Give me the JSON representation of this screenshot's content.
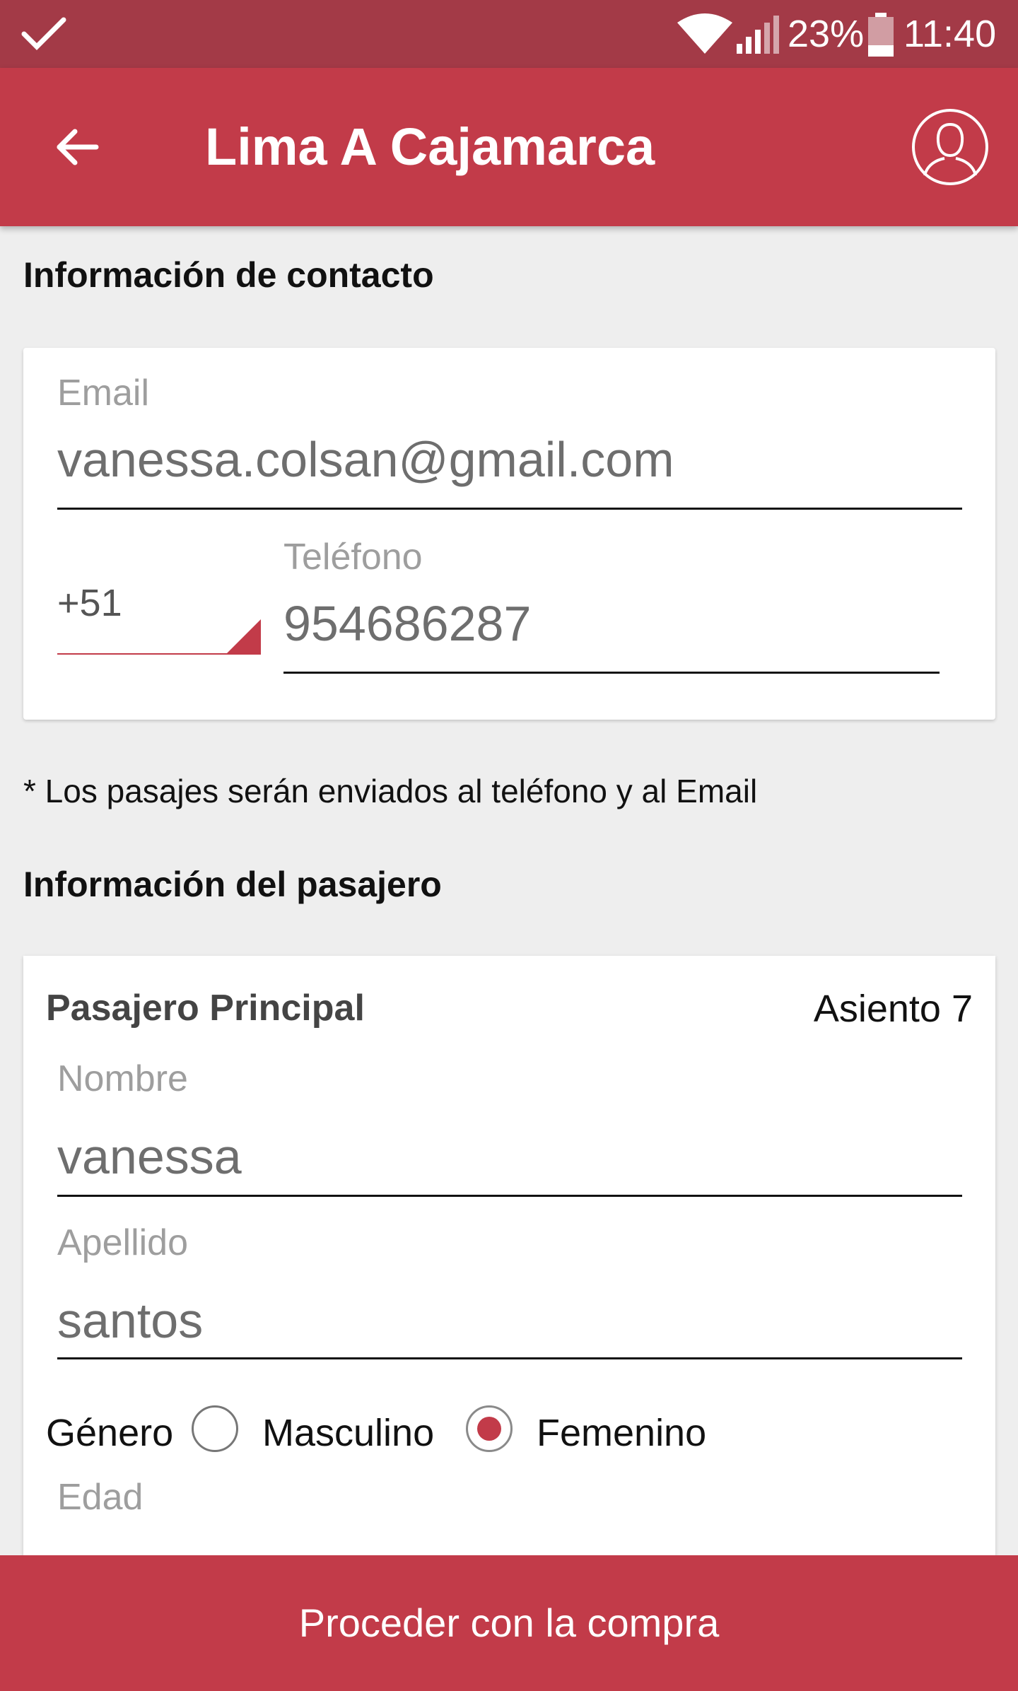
{
  "status_bar": {
    "battery": "23%",
    "time": "11:40",
    "icons": [
      "check-icon",
      "wifi-icon",
      "signal-icon",
      "battery-icon"
    ]
  },
  "toolbar": {
    "title": "Lima A Cajamarca",
    "back_icon": "arrow-left-icon",
    "profile_icon": "user-avatar-icon"
  },
  "contact": {
    "section_title": "Información de contacto",
    "email_label": "Email",
    "email_value": "vanessa.colsan@gmail.com",
    "country_code": "+51",
    "phone_label": "Teléfono",
    "phone_value": "954686287",
    "note": "* Los pasajes serán enviados al teléfono y al Email"
  },
  "passenger": {
    "section_title": "Información del pasajero",
    "card_title": "Pasajero Principal",
    "seat": "Asiento 7",
    "name_label": "Nombre",
    "name_value": "vanessa",
    "lastname_label": "Apellido",
    "lastname_value": "santos",
    "gender_label": "Género",
    "gender_options": [
      "Masculino",
      "Femenino"
    ],
    "gender_selected": "Femenino",
    "age_label": "Edad"
  },
  "actions": {
    "proceed_label": "Proceder con la compra"
  },
  "colors": {
    "accent": "#c23b49",
    "status_bar": "#a33a47",
    "background": "#eeeeee"
  }
}
